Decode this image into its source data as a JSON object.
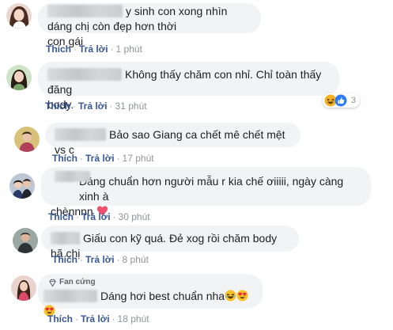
{
  "comments": [
    {
      "text_line1": "y sinh con xong nhìn dáng chị còn đẹp hơn thời",
      "text_line2": "con gái",
      "like_label": "Thích",
      "reply_label": "Trả lời",
      "time": "1 phút"
    },
    {
      "text_line1": "Không thấy chăm con nhỉ. Chỉ toàn thấy đăng",
      "text_line2": "body.",
      "like_label": "Thích",
      "reply_label": "Trả lời",
      "time": "31 phút",
      "reaction_count": "3",
      "reaction_icons": [
        "haha-icon",
        "like-icon"
      ]
    },
    {
      "text": "Bảo sao Giang ca chết mê chết mệt vs c",
      "like_label": "Thích",
      "reply_label": "Trả lời",
      "time": "17 phút"
    },
    {
      "text_line1": "Dáng chuẩn hơn người mẫu r kia chế ơiiiii, ngày càng xinh à",
      "text_line2": "chènnnn",
      "trailing_emoji": "red-heart-icon",
      "like_label": "Thích",
      "reply_label": "Trả lời",
      "time": "30 phút"
    },
    {
      "text": "Giấu con kỹ quá. Đẻ xog rồi chăm body hã chị",
      "like_label": "Thích",
      "reply_label": "Trả lời",
      "time": "8 phút"
    },
    {
      "badge": "Fan cứng",
      "text": "Dáng hơi best chuẩn nha",
      "trailing_emojis": [
        "laughing-face-icon",
        "heart-eyes-icon",
        "heart-eyes-icon"
      ],
      "like_label": "Thích",
      "reply_label": "Trả lời",
      "time": "18 phút"
    }
  ],
  "colors": {
    "bubble_bg": "#f2f3f5",
    "action_link": "#385898",
    "meta_text": "#90949c"
  }
}
